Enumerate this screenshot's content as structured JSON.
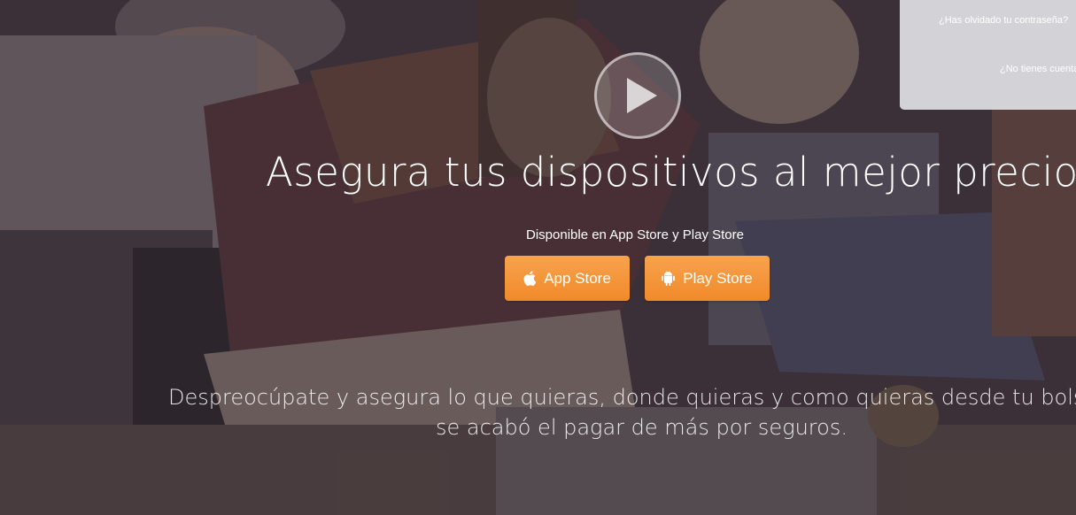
{
  "login": {
    "forgot_password": "¿Has olvidado tu contraseña?",
    "no_account": "¿No tienes cuenta"
  },
  "hero": {
    "headline": "Asegura tus dispositivos al mejor precio",
    "availability": "Disponible en App Store y Play Store",
    "app_store_label": "App Store",
    "play_store_label": "Play Store",
    "subtext_line1": "Despreocúpate y asegura lo que quieras, donde quieras y como quieras desde tu bolsi",
    "subtext_line2": "se acabó el pagar de más por seguros."
  },
  "icons": {
    "play": "play-icon",
    "apple": "apple-icon",
    "android": "android-icon"
  },
  "colors": {
    "accent": "#f39234",
    "text": "#ffffff"
  }
}
